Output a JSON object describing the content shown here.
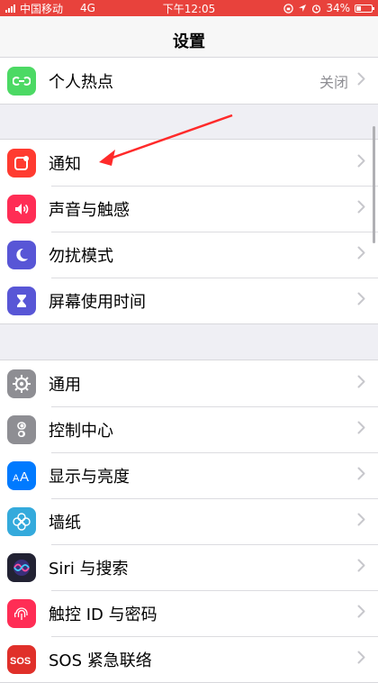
{
  "status_bar": {
    "carrier": "中国移动",
    "network": "4G",
    "time": "下午12:05",
    "battery_text": "34%",
    "battery_level": 0.34
  },
  "header": {
    "title": "设置"
  },
  "groups": [
    {
      "rows": [
        {
          "label": "个人热点",
          "value": "关闭",
          "icon": "hotspot-icon",
          "color": "#4cd964"
        }
      ]
    },
    {
      "rows": [
        {
          "label": "通知",
          "icon": "notification-icon",
          "color": "#ff3b30"
        },
        {
          "label": "声音与触感",
          "icon": "speaker-icon",
          "color": "#ff2d55"
        },
        {
          "label": "勿扰模式",
          "icon": "moon-icon",
          "color": "#5856d6"
        },
        {
          "label": "屏幕使用时间",
          "icon": "hourglass-icon",
          "color": "#5856d6"
        }
      ]
    },
    {
      "rows": [
        {
          "label": "通用",
          "icon": "gear-icon",
          "color": "#8e8e93"
        },
        {
          "label": "控制中心",
          "icon": "toggle-icon",
          "color": "#8e8e93"
        },
        {
          "label": "显示与亮度",
          "icon": "text-size-icon",
          "color": "#007aff"
        },
        {
          "label": "墙纸",
          "icon": "flower-icon",
          "color": "#34aadc"
        },
        {
          "label": "Siri 与搜索",
          "icon": "siri-icon",
          "color": "#222233"
        },
        {
          "label": "触控 ID 与密码",
          "icon": "fingerprint-icon",
          "color": "#ff2d55"
        },
        {
          "label": "SOS 紧急联络",
          "icon": "sos-icon",
          "color": "#e0302a"
        }
      ]
    }
  ]
}
